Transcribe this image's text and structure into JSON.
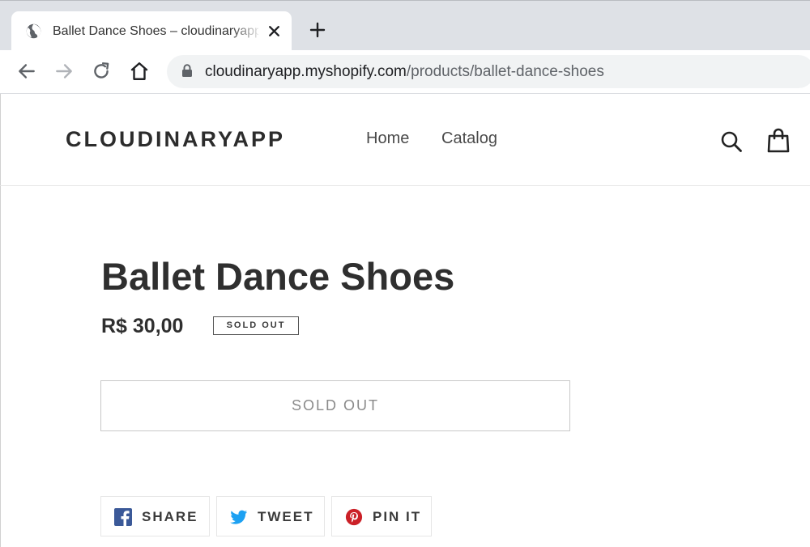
{
  "browser": {
    "tab_title": "Ballet Dance Shoes – cloudinaryapp",
    "url_host": "cloudinaryapp.myshopify.com",
    "url_path": "/products/ballet-dance-shoes"
  },
  "store": {
    "brand": "CLOUDINARYAPP",
    "nav": {
      "home": "Home",
      "catalog": "Catalog"
    }
  },
  "product": {
    "title": "Ballet Dance Shoes",
    "price": "R$ 30,00",
    "badge": "SOLD OUT",
    "button_label": "SOLD OUT"
  },
  "social": {
    "share": "SHARE",
    "tweet": "TWEET",
    "pin": "PIN IT"
  },
  "colors": {
    "facebook": "#3b5998",
    "twitter": "#1da1f2",
    "pinterest": "#cb2027"
  }
}
